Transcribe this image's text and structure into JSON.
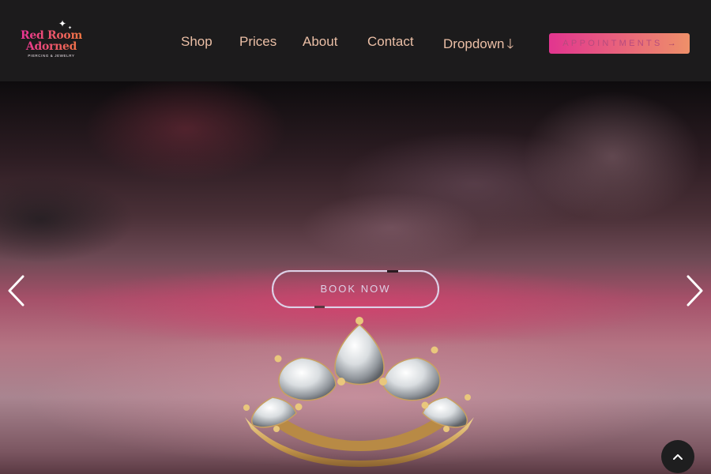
{
  "brand": {
    "name_line1": "Red Room",
    "name_line2": "Adorned",
    "tagline": "PIERCING & JEWELRY"
  },
  "nav": {
    "shop": "Shop",
    "prices": "Prices",
    "about": "About",
    "contact": "Contact",
    "dropdown": "Dropdown"
  },
  "cta": {
    "appointments": "APPOINTMENTS",
    "appointments_arrow": "→"
  },
  "hero": {
    "book_now": "BOOK NOW",
    "image_subject": "gold crown-shaped jewelry end set with pear-cut crystals"
  },
  "icons": {
    "nav_dropdown": "arrow-down-icon",
    "prev": "chevron-left-icon",
    "next": "chevron-right-icon",
    "back_to_top": "chevron-up-icon",
    "sparkle": "sparkle-icon"
  },
  "colors": {
    "header_bg": "#1c1b1c",
    "nav_text": "#ebbfa6",
    "brand_gradient_start": "#ea2f9a",
    "brand_gradient_end": "#f07a3e",
    "button_outline": "#ddd0e6"
  }
}
